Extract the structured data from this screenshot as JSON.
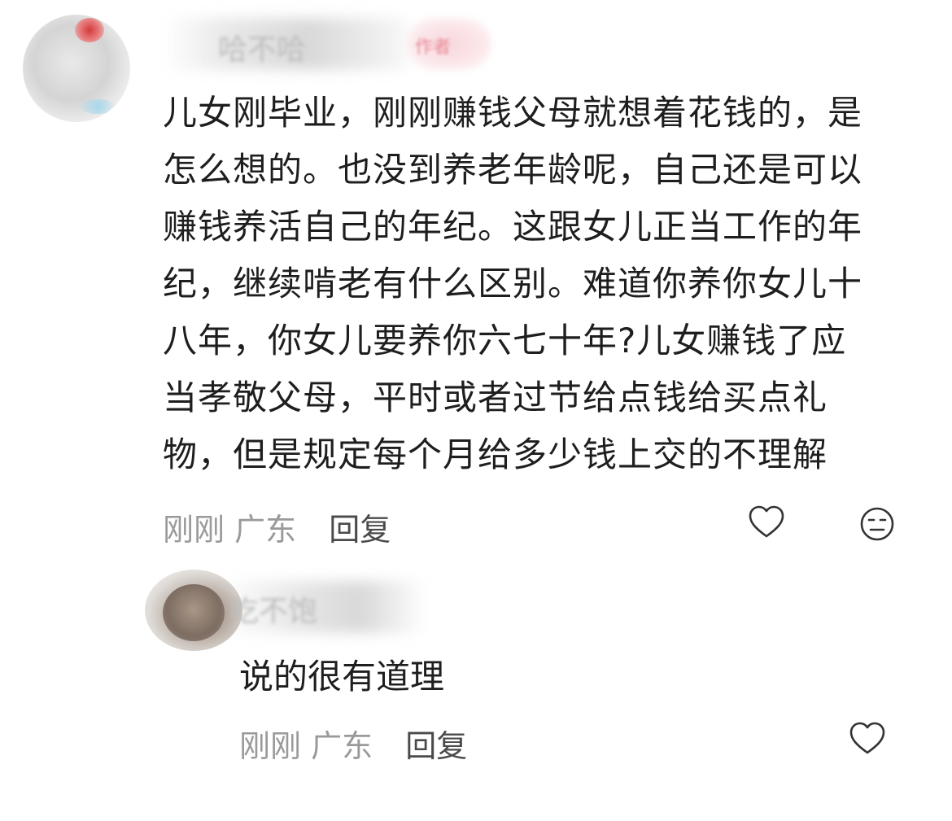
{
  "comment": {
    "username": "哈不哈",
    "author_tag": "作者",
    "text_lines": [
      "儿女刚毕业，刚刚赚钱父母就想着花钱的，是",
      "怎么想的。也没到养老年龄呢，自己还是可以",
      "赚钱养活自己的年纪。这跟女儿正当工作的年",
      "纪，继续啃老有什么区别。难道你养你女儿十",
      "八年，你女儿要养你六七十年?儿女赚钱了应",
      "当孝敬父母，平时或者过节给点钱给买点礼",
      "物，但是规定每个月给多少钱上交的不理解"
    ],
    "time": "刚刚",
    "location": "广东",
    "reply_label": "回复",
    "icons": [
      "heart-outline-icon",
      "expressionless-face-icon"
    ]
  },
  "reply": {
    "username": "吃不饱",
    "text": "说的很有道理",
    "time": "刚刚",
    "location": "广东",
    "reply_label": "回复",
    "icons": [
      "heart-outline-icon"
    ]
  },
  "colors": {
    "text": "#1e1e1e",
    "meta": "#9a9a9a",
    "reply_action": "#4a4a4a",
    "icon_stroke": "#333333"
  }
}
